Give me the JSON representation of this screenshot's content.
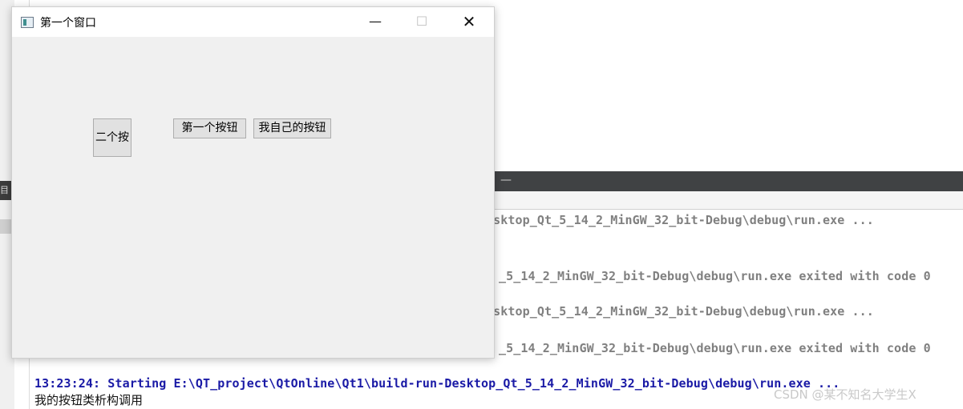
{
  "window": {
    "title": "第一个窗口",
    "controls": {
      "minimize": "—",
      "maximize": "☐",
      "close": "✕"
    },
    "buttons": {
      "second": "二个按",
      "first": "第一个按钮",
      "mine": "我自己的按钮"
    }
  },
  "ide": {
    "left_tab_text": "目",
    "output_minimize": "—",
    "log_lines": [
      "esktop_Qt_5_14_2_MinGW_32_bit-Debug\\debug\\run.exe ...",
      "_5_14_2_MinGW_32_bit-Debug\\debug\\run.exe exited with code 0",
      "esktop_Qt_5_14_2_MinGW_32_bit-Debug\\debug\\run.exe ...",
      "_5_14_2_MinGW_32_bit-Debug\\debug\\run.exe exited with code 0"
    ],
    "start_line": "13:23:24: Starting E:\\QT_project\\QtOnline\\Qt1\\build-run-Desktop_Qt_5_14_2_MinGW_32_bit-Debug\\debug\\run.exe ...",
    "output_text": "我的按钮类析构调用"
  },
  "watermark": "CSDN @某不知名大学生X",
  "colors": {
    "log_gray": "#808080",
    "log_blue": "#1a1aa6",
    "output_header": "#404244"
  }
}
